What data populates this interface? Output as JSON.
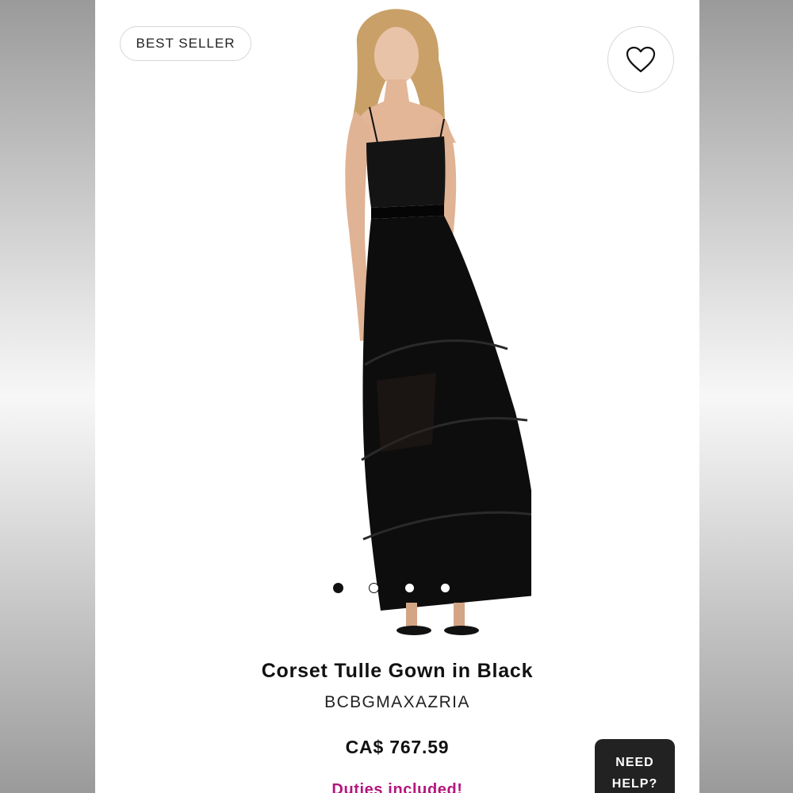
{
  "product": {
    "badge": "BEST SELLER",
    "title": "Corset Tulle Gown in Black",
    "brand": "BCBGMAXAZRIA",
    "price": "CA$ 767.59",
    "duties_note": "Duties included!"
  },
  "gallery": {
    "image_count": 4,
    "active_index": 0
  },
  "icons": {
    "wishlist": "heart-icon"
  },
  "help_button": {
    "line1": "NEED",
    "line2": "HELP?"
  },
  "colors": {
    "accent": "#b4157e",
    "text": "#111111",
    "help_bg": "#222222"
  }
}
